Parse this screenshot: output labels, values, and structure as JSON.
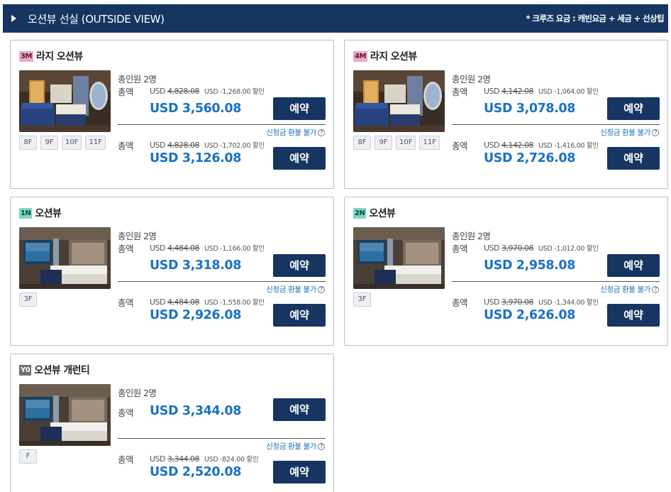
{
  "header": {
    "title": "오션뷰 선실 (OUTSIDE VIEW)",
    "note": "* 크루즈 요금 : 캐빈요금 + 세금 + 선상팁"
  },
  "labels": {
    "pax": "총인원 2명",
    "total": "총액",
    "reserve": "예약",
    "refund": "신청금 환불 불가",
    "help": "?",
    "usd": "USD"
  },
  "cards": [
    {
      "code": "3M",
      "badge_color": "#f0a8c8",
      "name": "라지 오션뷰",
      "photo": "large-oceanview-room",
      "decks": [
        "8F",
        "9F",
        "10F",
        "11F"
      ],
      "prices": [
        {
          "original": "4,828.08",
          "discount": "USD -1,268.00 할인",
          "final": "USD 3,560.08"
        },
        {
          "original": "4,828.08",
          "discount": "USD -1,702.00 할인",
          "final": "USD 3,126.08"
        }
      ]
    },
    {
      "code": "4M",
      "badge_color": "#f0a8c8",
      "name": "라지 오션뷰",
      "photo": "large-oceanview-room",
      "decks": [
        "8F",
        "9F",
        "10F",
        "11F"
      ],
      "prices": [
        {
          "original": "4,142.08",
          "discount": "USD -1,064.00 할인",
          "final": "USD 3,078.08"
        },
        {
          "original": "4,142.08",
          "discount": "USD -1,416.00 할인",
          "final": "USD 2,726.08"
        }
      ]
    },
    {
      "code": "1N",
      "badge_color": "#7fd6c6",
      "name": "오션뷰",
      "photo": "oceanview-room",
      "decks": [
        "3F"
      ],
      "prices": [
        {
          "original": "4,484.08",
          "discount": "USD -1,166.00 할인",
          "final": "USD 3,318.08"
        },
        {
          "original": "4,484.08",
          "discount": "USD -1,558.00 할인",
          "final": "USD 2,926.08"
        }
      ]
    },
    {
      "code": "2N",
      "badge_color": "#7fd6c6",
      "name": "오션뷰",
      "photo": "oceanview-room",
      "decks": [
        "3F"
      ],
      "prices": [
        {
          "original": "3,970.08",
          "discount": "USD -1,012.00 할인",
          "final": "USD 2,958.08"
        },
        {
          "original": "3,970.08",
          "discount": "USD -1,344.00 할인",
          "final": "USD 2,626.08"
        }
      ]
    },
    {
      "code": "Y0",
      "badge_color": "#707070",
      "name": "오션뷰 개런티",
      "photo": "oceanview-room",
      "decks": [
        "F"
      ],
      "prices": [
        {
          "original": "",
          "discount": "",
          "final": "USD 3,344.08"
        },
        {
          "original": "3,344.08",
          "discount": "USD -824.00 할인",
          "final": "USD 2,520.08"
        }
      ]
    }
  ]
}
